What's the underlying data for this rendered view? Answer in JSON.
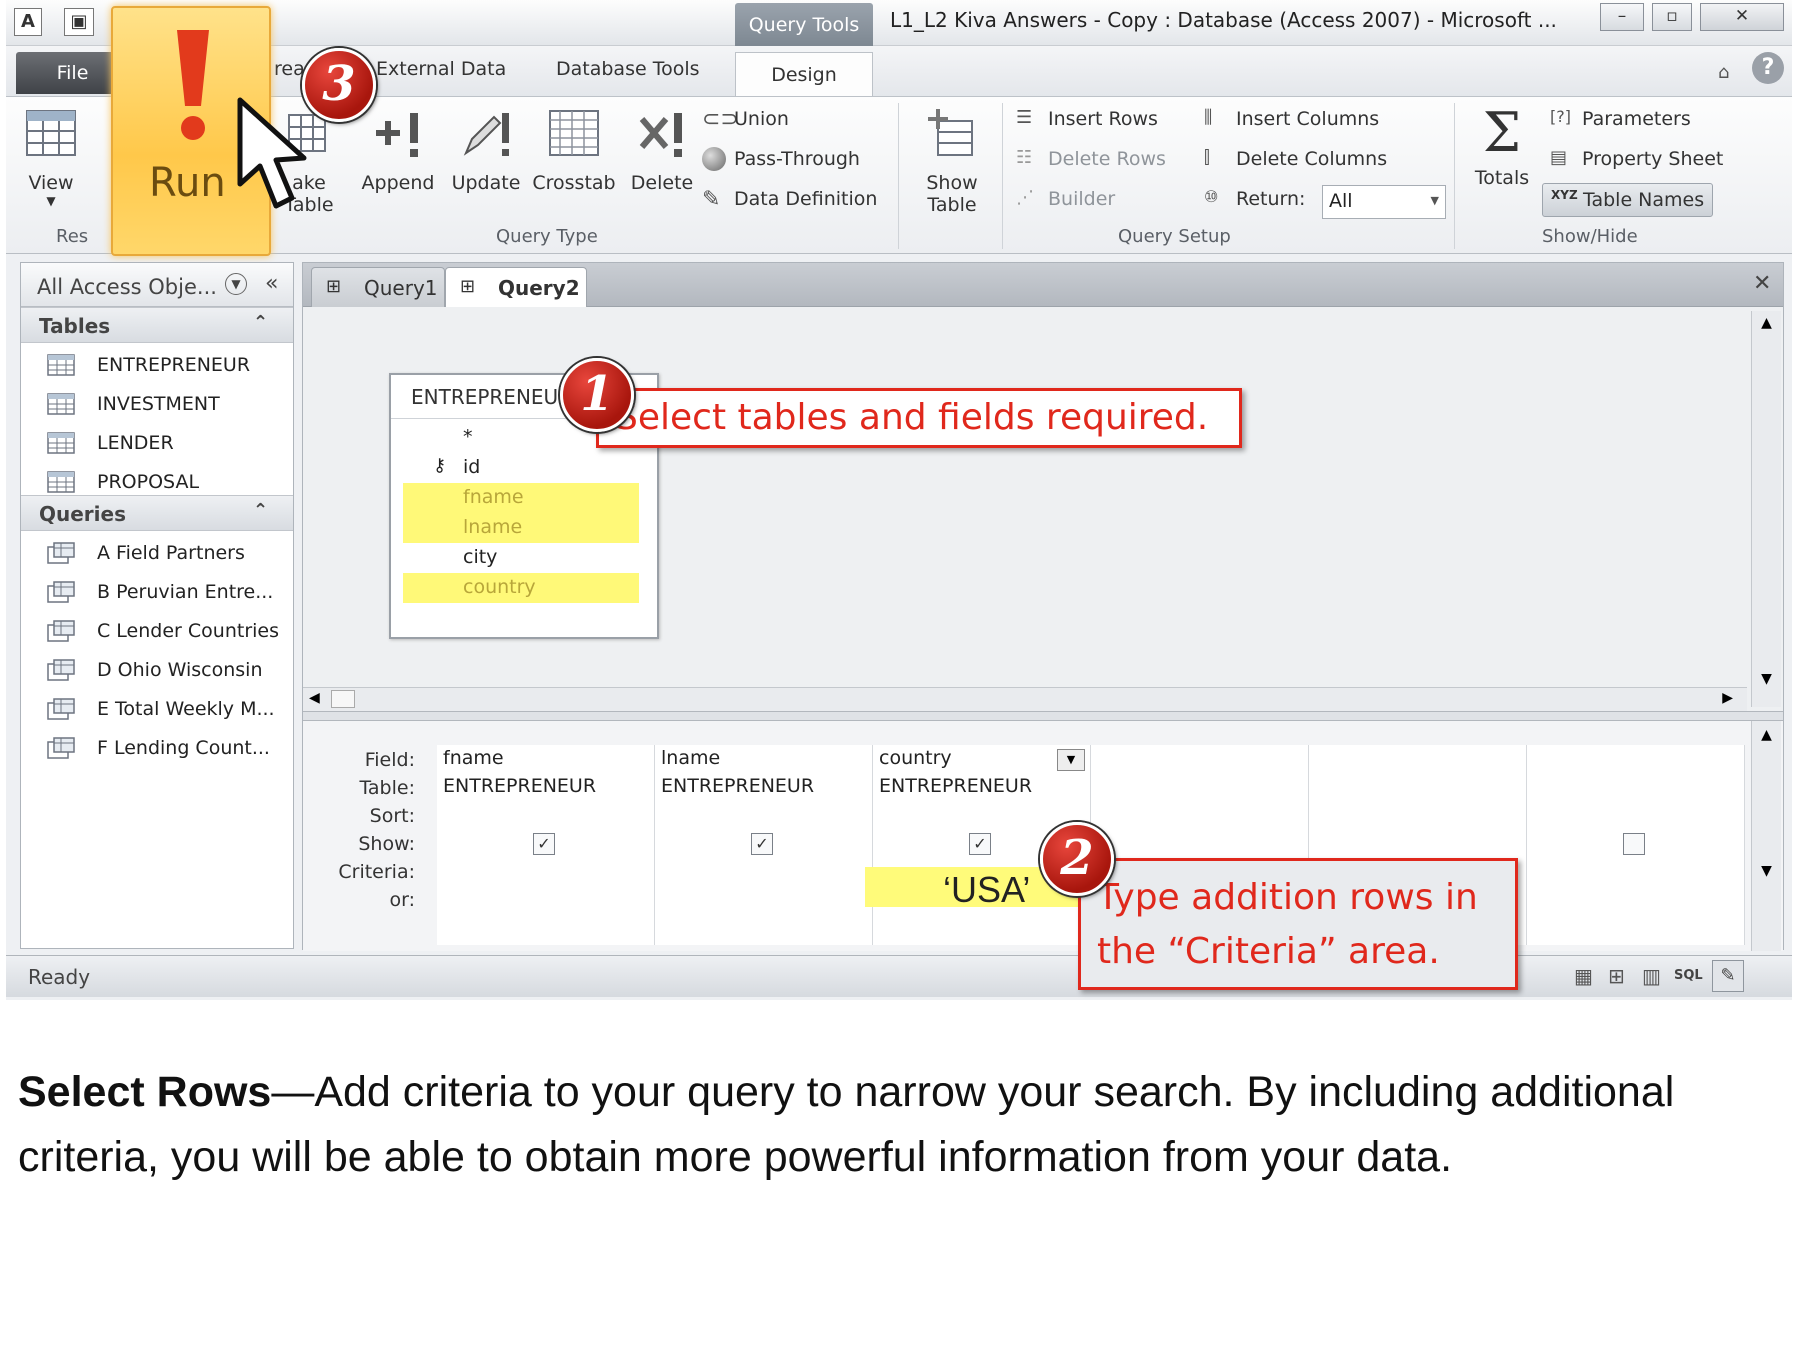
{
  "window": {
    "context_tab": "Query Tools",
    "title": "L1_L2 Kiva Answers - Copy : Database (Access 2007)  -  Microsoft ..."
  },
  "ribbon_tabs": {
    "file": "File",
    "create": "rea",
    "external": "External Data",
    "dbtools": "Database Tools",
    "design": "Design"
  },
  "ribbon": {
    "results": {
      "view": "View",
      "run": "Run",
      "group": "Res"
    },
    "query_type": {
      "make_table_1": "ake",
      "make_table_2": "Table",
      "append": "Append",
      "update": "Update",
      "crosstab": "Crosstab",
      "delete": "Delete",
      "union": "Union",
      "pass_through": "Pass-Through",
      "data_definition": "Data Definition",
      "group": "Query Type"
    },
    "query_setup": {
      "show_table_1": "Show",
      "show_table_2": "Table",
      "insert_rows": "Insert Rows",
      "delete_rows": "Delete Rows",
      "builder": "Builder",
      "insert_columns": "Insert Columns",
      "delete_columns": "Delete Columns",
      "return_label": "Return:",
      "return_value": "All",
      "group": "Query Setup"
    },
    "show_hide": {
      "totals": "Totals",
      "parameters": "Parameters",
      "property_sheet": "Property Sheet",
      "table_names": "Table Names",
      "group": "Show/Hide"
    }
  },
  "nav": {
    "header": "All Access Obje...",
    "tables_label": "Tables",
    "tables": [
      "ENTREPRENEUR",
      "INVESTMENT",
      "LENDER",
      "PROPOSAL"
    ],
    "queries_label": "Queries",
    "queries": [
      "A Field Partners",
      "B Peruvian Entre...",
      "C Lender Countries",
      "D Ohio Wisconsin",
      "E Total Weekly M...",
      "F Lending Count..."
    ]
  },
  "doc_tabs": [
    "Query1",
    "Query2"
  ],
  "field_table": {
    "name": "ENTREPRENEUR",
    "fields": [
      "*",
      "id",
      "fname",
      "lname",
      "city",
      "country"
    ]
  },
  "grid": {
    "row_labels": [
      "Field:",
      "Table:",
      "Sort:",
      "Show:",
      "Criteria:",
      "or:"
    ],
    "columns": [
      {
        "field": "fname",
        "table": "ENTREPRENEUR",
        "show": "✓"
      },
      {
        "field": "lname",
        "table": "ENTREPRENEUR",
        "show": "✓"
      },
      {
        "field": "country",
        "table": "ENTREPRENEUR",
        "show": "✓",
        "criteria": "‘USA’"
      }
    ]
  },
  "status": {
    "text": "Ready",
    "sql": "SQL"
  },
  "callouts": {
    "c1_num": "1",
    "c1_text": "Select tables and fields required.",
    "c2_num": "2",
    "c2_line1": "Type addition rows in",
    "c2_line2": "the “Criteria” area.",
    "c3_num": "3"
  },
  "caption": {
    "bold": "Select Rows",
    "text": "—Add criteria to your query to narrow your search.  By including additional criteria, you will be able to obtain more powerful information from your data."
  },
  "colors": {
    "callout_red": "#e0281c",
    "highlight": "#fff978",
    "run_glow": "#ffc84a"
  }
}
